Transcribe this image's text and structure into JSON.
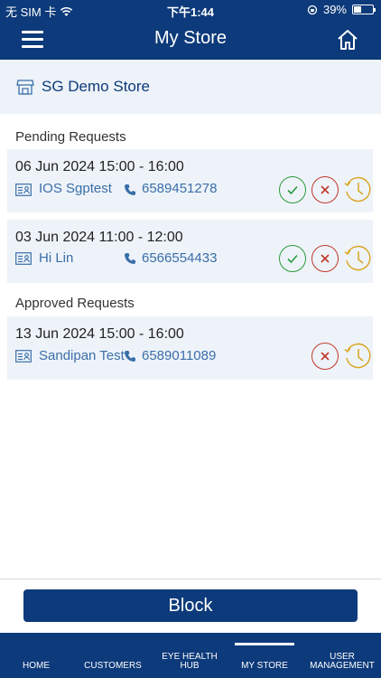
{
  "status_bar": {
    "carrier": "无 SIM 卡",
    "time": "下午1:44",
    "battery_percent": "39%",
    "battery_level": 0.39
  },
  "header": {
    "title": "My Store"
  },
  "store": {
    "name": "SG Demo Store"
  },
  "pending": {
    "label": "Pending Requests",
    "items": [
      {
        "datetime": "06 Jun 2024 15:00 - 16:00",
        "name": "IOS Sgptest",
        "phone": "6589451278"
      },
      {
        "datetime": "03 Jun 2024 11:00 - 12:00",
        "name": "Hi Lin",
        "phone": "6566554433"
      }
    ]
  },
  "approved": {
    "label": "Approved Requests",
    "items": [
      {
        "datetime": "13 Jun 2024 15:00 - 16:00",
        "name": "Sandipan Test",
        "phone": "6589011089"
      }
    ]
  },
  "actions": {
    "block_label": "Block"
  },
  "tabs": [
    {
      "label": "HOME",
      "active": false
    },
    {
      "label": "CUSTOMERS",
      "active": false
    },
    {
      "label": "EYE HEALTH HUB",
      "active": false
    },
    {
      "label": "MY STORE",
      "active": true
    },
    {
      "label": "USER MANAGEMENT",
      "active": false
    }
  ],
  "colors": {
    "brand": "#0d3a7a",
    "approve": "#2b9a3a",
    "reject": "#c0392b",
    "reschedule": "#d9a520"
  }
}
